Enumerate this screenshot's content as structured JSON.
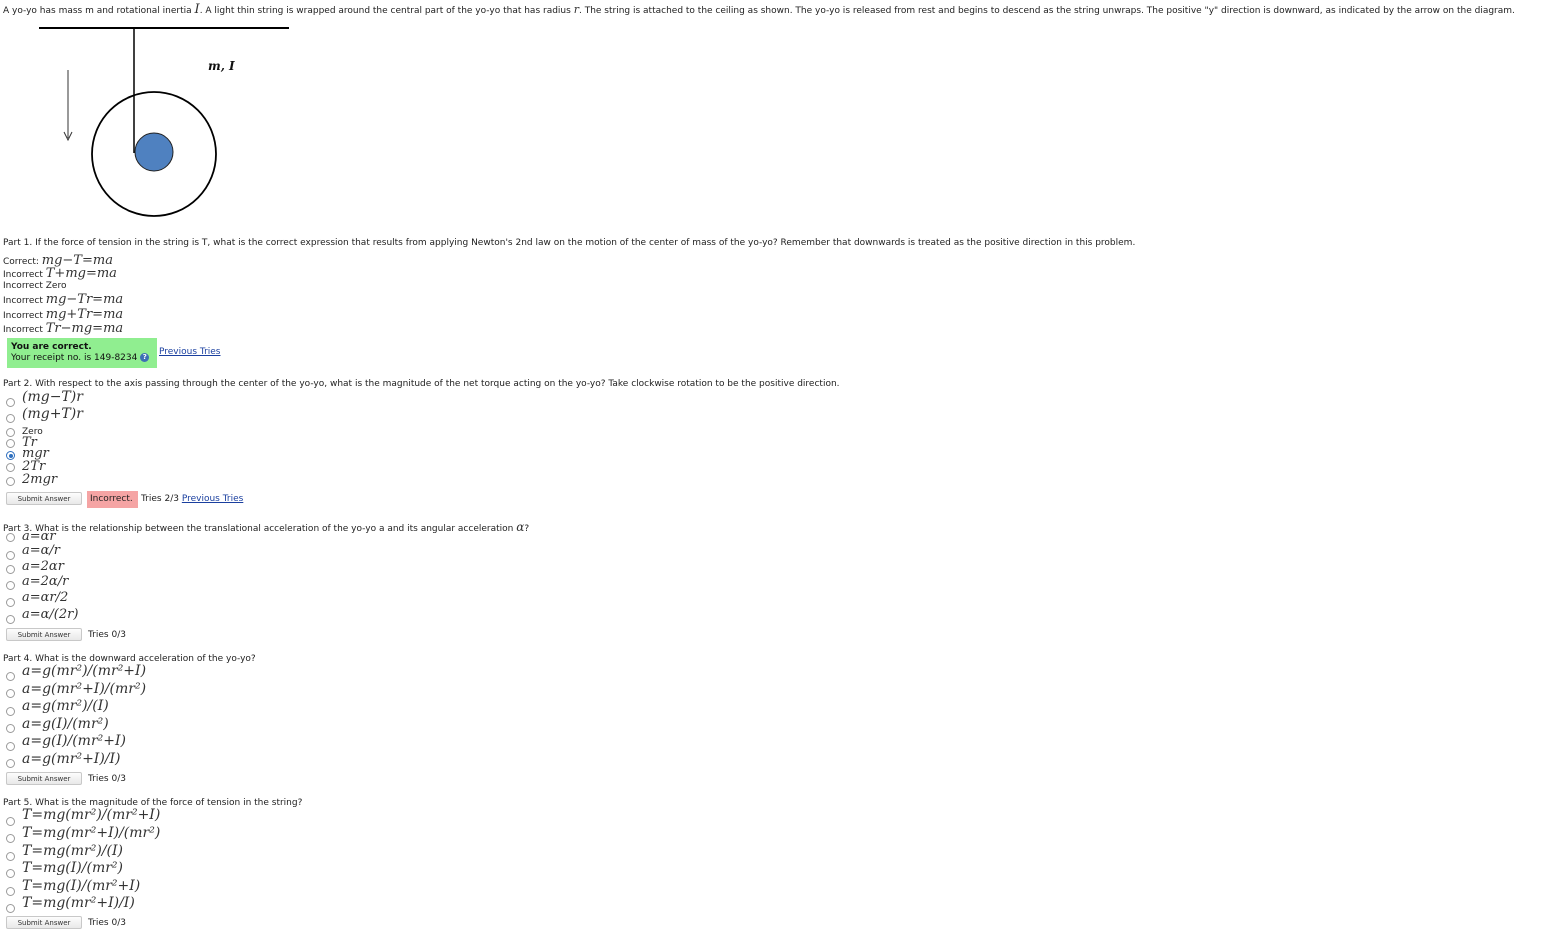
{
  "intro": {
    "text_before": "A yo-yo has mass m and rotational inertia",
    "inertia_symbol": "I",
    "text_mid": ". A light thin string is wrapped around the central part of the yo-yo that has radius",
    "radius_symbol": "r",
    "text_after": ". The string is attached to the ceiling as shown. The yo-yo is released from rest and begins to descend as the string unwraps. The positive \"y\" direction is downward, as indicated by the arrow on the diagram."
  },
  "diagram": {
    "label": "m, I",
    "inner_color": "#4f81c0"
  },
  "part1": {
    "question": "Part 1. If the force of tension in the string is T, what is the correct expression that results from applying Newton's 2nd law on the motion of the center of mass of the yo-yo? Remember that downwards is treated as the positive direction in this problem.",
    "rows": [
      {
        "status": "Correct:",
        "expr": "mg−T=ma"
      },
      {
        "status": "Incorrect",
        "expr": "T+mg=ma"
      },
      {
        "status": "Incorrect",
        "expr": "Zero"
      },
      {
        "status": "Incorrect",
        "expr": "mg−Tr=ma"
      },
      {
        "status": "Incorrect",
        "expr": "mg+Tr=ma"
      },
      {
        "status": "Incorrect",
        "expr": "Tr−mg=ma"
      }
    ],
    "feedback_title": "You are correct.",
    "receipt": "Your receipt no. is 149-8234",
    "help_glyph": "?",
    "previous_tries": "Previous Tries"
  },
  "part2": {
    "question": "Part 2. With respect to the axis passing through the center of the yo-yo, what is the magnitude of the net torque acting on the yo-yo? Take clockwise rotation to be the positive direction.",
    "options": [
      "(mg−T)r",
      "(mg+T)r",
      "Zero",
      "Tr",
      "mgr",
      "2Tr",
      "2mgr"
    ],
    "selected_index": 4,
    "submit_label": "Submit Answer",
    "result": "Incorrect.",
    "tries": "Tries 2/3",
    "previous_tries": "Previous Tries",
    "colors": {
      "incorrect_bg": "#f5a4a4"
    }
  },
  "part3": {
    "question": "Part 3. What is the relationship between the translational acceleration of the yo-yo a and its angular acceleration",
    "question_symbol": "α",
    "question_end": "?",
    "options": [
      "a=αr",
      "a=α/r",
      "a=2αr",
      "a=2α/r",
      "a=αr/2",
      "a=α/(2r)"
    ],
    "submit_label": "Submit Answer",
    "tries": "Tries 0/3"
  },
  "part4": {
    "question": "Part 4. What is the downward acceleration of the yo-yo?",
    "options": [
      "a=g(mr²)/(mr²+I)",
      "a=g(mr²+I)/(mr²)",
      "a=g(mr²)/(I)",
      "a=g(I)/(mr²)",
      "a=g(I)/(mr²+I)",
      "a=g(mr²+I)/I)"
    ],
    "submit_label": "Submit Answer",
    "tries": "Tries 0/3"
  },
  "part5": {
    "question": "Part 5. What is the magnitude of the force of tension in the string?",
    "options": [
      "T=mg(mr²)/(mr²+I)",
      "T=mg(mr²+I)/(mr²)",
      "T=mg(mr²)/(I)",
      "T=mg(I)/(mr²)",
      "T=mg(I)/(mr²+I)",
      "T=mg(mr²+I)/I)"
    ],
    "submit_label": "Submit Answer",
    "tries": "Tries 0/3"
  },
  "colors": {
    "correct_bg": "#90ee90",
    "link": "#1a3f9f",
    "radio_selected": "#2e6fbf"
  }
}
